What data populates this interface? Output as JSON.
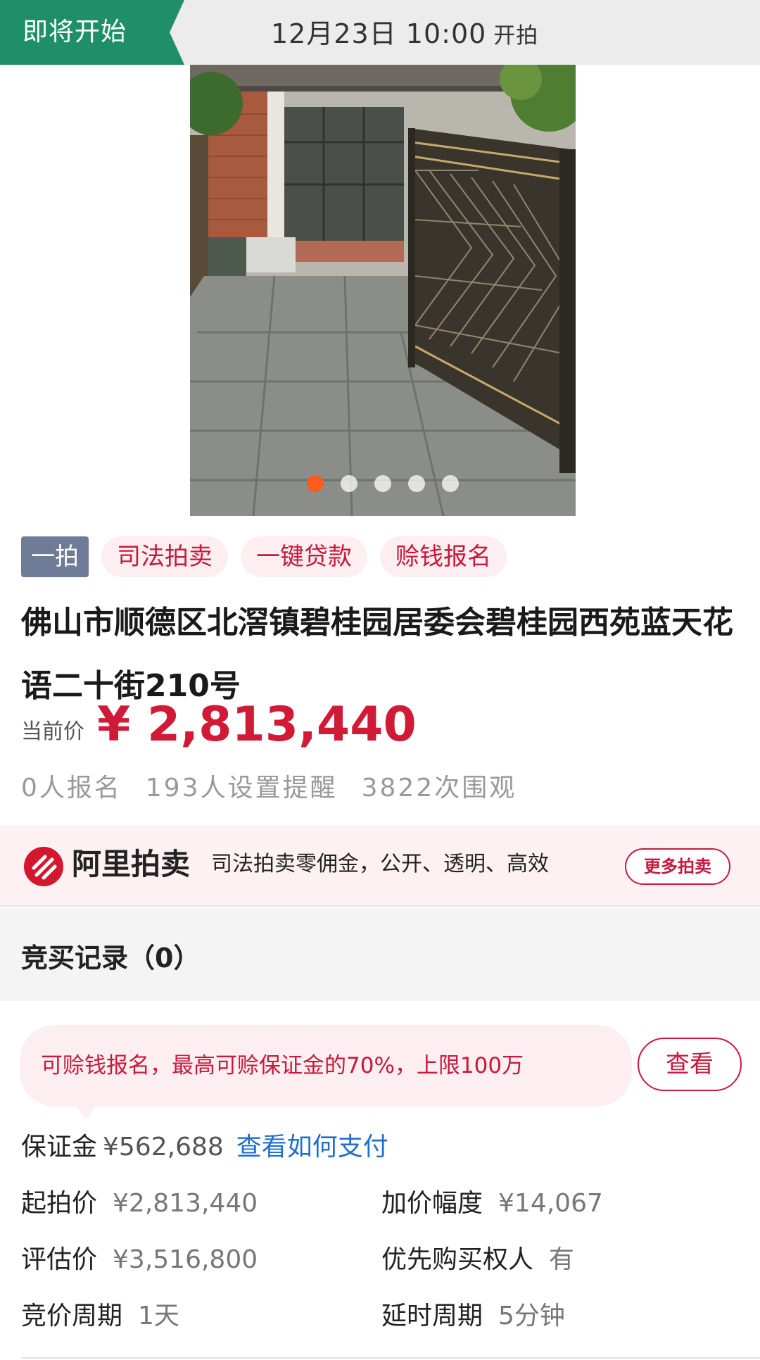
{
  "header": {
    "status": "即将开始",
    "start_time": "12月23日 10:00",
    "start_suffix": "开拍"
  },
  "gallery": {
    "image_count": 5,
    "active_index": 0
  },
  "tags": {
    "round": "一拍",
    "items": [
      "司法拍卖",
      "一键贷款",
      "赊钱报名"
    ]
  },
  "title": "佛山市顺德区北滘镇碧桂园居委会碧桂园西苑蓝天花语二十街210号",
  "price": {
    "label": "当前价",
    "value": "¥ 2,813,440"
  },
  "stats": {
    "signups": "0人报名",
    "reminders": "193人设置提醒",
    "views": "3822次围观"
  },
  "ali_band": {
    "logo_text": "阿里拍卖",
    "slogan": "司法拍卖零佣金，公开、透明、高效",
    "more_button": "更多拍卖"
  },
  "bid_record": {
    "title": "竞买记录（0）"
  },
  "loan_note": {
    "text": "可赊钱报名，最高可赊保证金的70%，上限100万",
    "button": "查看"
  },
  "deposit": {
    "label": "保证金",
    "value": "¥562,688",
    "link": "查看如何支付"
  },
  "details": {
    "start_price": {
      "label": "起拍价",
      "value": "¥2,813,440"
    },
    "increment": {
      "label": "加价幅度",
      "value": "¥14,067"
    },
    "appraisal": {
      "label": "评估价",
      "value": "¥3,516,800"
    },
    "priority": {
      "label": "优先购买权人",
      "value": "有"
    },
    "cycle": {
      "label": "竞价周期",
      "value": "1天"
    },
    "extension": {
      "label": "延时周期",
      "value": "5分钟"
    }
  },
  "colors": {
    "status_green": "#1f8f6a",
    "accent_red": "#d11a36",
    "link_blue": "#1e6fd0"
  }
}
